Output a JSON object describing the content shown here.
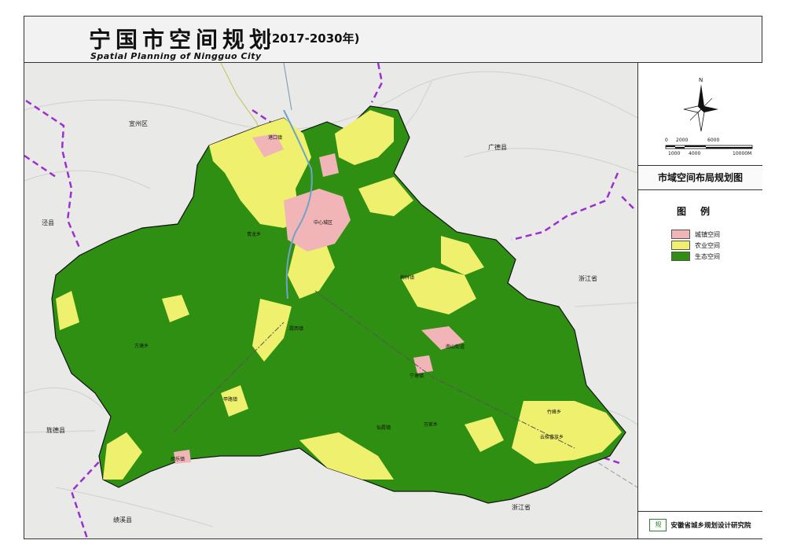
{
  "header": {
    "title_cn": "宁国市空间规划",
    "title_years": "(2017-2030年)",
    "title_en": "Spatial Planning of Ningguo City"
  },
  "sidebar": {
    "compass_label": "N",
    "scale_ticks": [
      "0",
      "2000",
      "6000",
      "1000",
      "4000",
      "10000M"
    ],
    "panel_title": "市域空间布局规划图",
    "legend_title": "图例",
    "legend_items": [
      {
        "label": "城镇空间",
        "color": "#f2b5b7"
      },
      {
        "label": "农业空间",
        "color": "#eef06e"
      },
      {
        "label": "生态空间",
        "color": "#2f8f12"
      }
    ],
    "org_logo": "规",
    "org_name": "安徽省城乡规划设计研究院"
  },
  "map": {
    "region_labels": {
      "xuanzhou": "宣州区",
      "jingxian": "泾县",
      "guangde": "广德县",
      "zhejiang_east": "浙江省",
      "jingde": "旌德县",
      "zhejiang_south": "浙江省",
      "jixi": "绩溪县"
    },
    "town_labels": {
      "gangkou": "港口镇",
      "center": "中心城区",
      "qingshui": "青龙乡",
      "meilin": "梅林镇",
      "xiaxi": "霞西镇",
      "fangtang": "方塘乡",
      "nanshan": "南山街道",
      "ningdun": "宁墩镇",
      "jiahe": "甲路镇",
      "hukeng": "胡乐镇",
      "tianhu": "仙霞镇",
      "wanjia": "万家乡",
      "yunti": "云梯畲族乡",
      "shouchang": "竹峰乡"
    },
    "colors": {
      "urban": "#f2b5b7",
      "agriculture": "#eef06e",
      "ecology": "#2f8f12",
      "boundary": "#9b2fd0",
      "base": "#e9eae8"
    }
  }
}
